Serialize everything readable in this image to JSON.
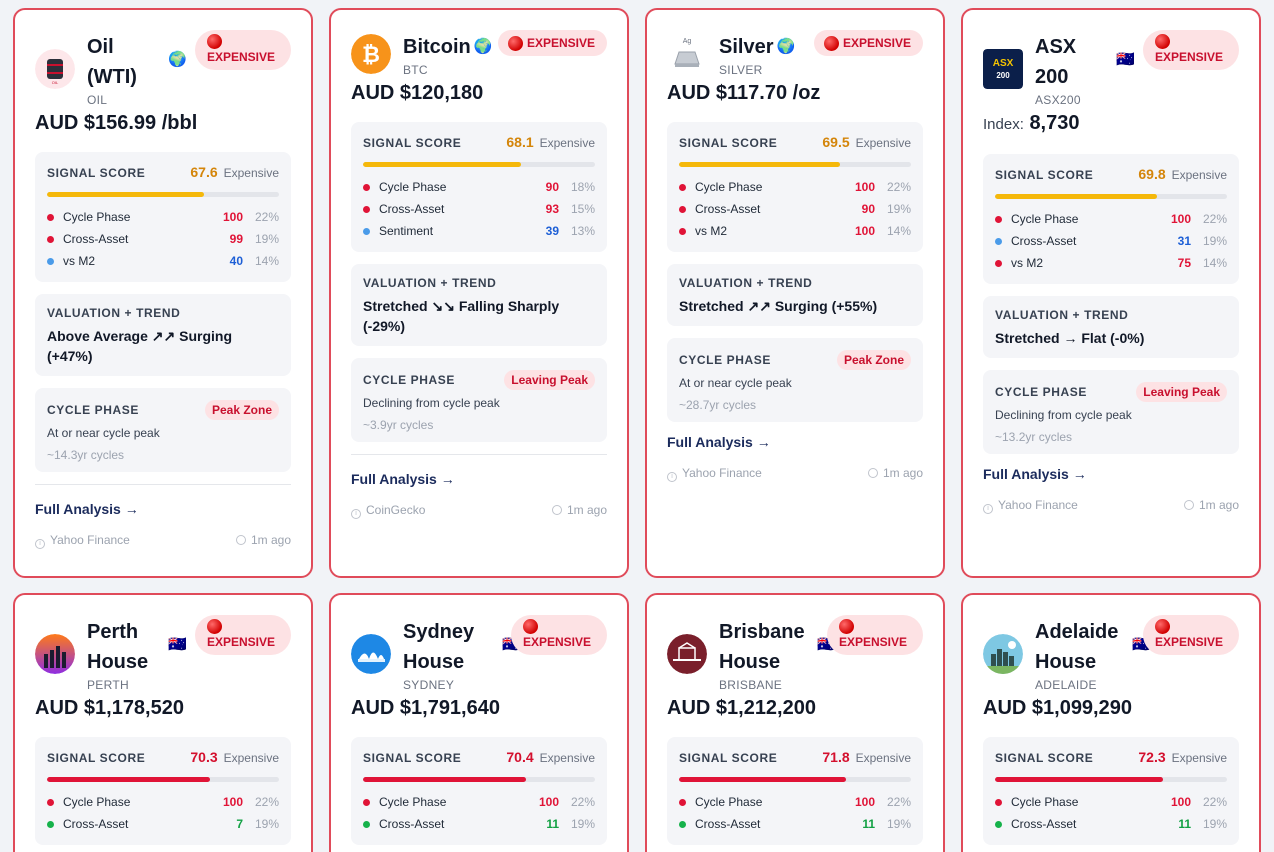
{
  "cards": [
    {
      "name": "Oil (WTI)",
      "ticker": "OIL",
      "flag": "🌍",
      "badge": "EXPENSIVE",
      "price": "AUD $156.99 /bbl",
      "signal": {
        "title": "SIGNAL SCORE",
        "score": "67.6",
        "label": "Expensive",
        "fill": 0.676
      },
      "metrics": [
        {
          "name": "Cycle Phase",
          "value": "100",
          "weight": "22%"
        },
        {
          "name": "Cross-Asset",
          "value": "99",
          "weight": "19%"
        },
        {
          "name": "vs M2",
          "value": "40",
          "weight": "14%"
        }
      ],
      "valuation": {
        "title": "VALUATION + TREND",
        "text": "Above Average ↗↗ Surging (+47%)"
      },
      "cycle": {
        "title": "CYCLE PHASE",
        "badge": "Peak Zone",
        "desc": "At or near cycle peak",
        "sub": "~14.3yr cycles"
      },
      "link": "Full Analysis →",
      "source": "Yahoo Finance",
      "time": "1m ago"
    },
    {
      "name": "Bitcoin",
      "ticker": "BTC",
      "flag": "🌍",
      "badge": "EXPENSIVE",
      "price": "AUD $120,180",
      "signal": {
        "title": "SIGNAL SCORE",
        "score": "68.1",
        "label": "Expensive",
        "fill": 0.681
      },
      "metrics": [
        {
          "name": "Cycle Phase",
          "value": "90",
          "weight": "18%"
        },
        {
          "name": "Cross-Asset",
          "value": "93",
          "weight": "15%"
        },
        {
          "name": "Sentiment",
          "value": "39",
          "weight": "13%"
        }
      ],
      "valuation": {
        "title": "VALUATION + TREND",
        "text": "Stretched ↘↘ Falling Sharply (-29%)"
      },
      "cycle": {
        "title": "CYCLE PHASE",
        "badge": "Leaving Peak",
        "desc": "Declining from cycle peak",
        "sub": "~3.9yr cycles"
      },
      "link": "Full Analysis →",
      "source": "CoinGecko",
      "time": "1m ago"
    },
    {
      "name": "Silver",
      "ticker": "SILVER",
      "flag": "🌍",
      "badge": "EXPENSIVE",
      "price": "AUD $117.70 /oz",
      "signal": {
        "title": "SIGNAL SCORE",
        "score": "69.5",
        "label": "Expensive",
        "fill": 0.695
      },
      "metrics": [
        {
          "name": "Cycle Phase",
          "value": "100",
          "weight": "22%"
        },
        {
          "name": "Cross-Asset",
          "value": "90",
          "weight": "19%"
        },
        {
          "name": "vs M2",
          "value": "100",
          "weight": "14%"
        }
      ],
      "valuation": {
        "title": "VALUATION + TREND",
        "text": "Stretched ↗↗ Surging (+55%)"
      },
      "cycle": {
        "title": "CYCLE PHASE",
        "badge": "Peak Zone",
        "desc": "At or near cycle peak",
        "sub": "~28.7yr cycles"
      },
      "link": "Full Analysis →",
      "source": "Yahoo Finance",
      "time": "1m ago"
    },
    {
      "name": "ASX 200",
      "ticker": "ASX200",
      "flag": "🇦🇺",
      "badge": "EXPENSIVE",
      "logo_text": "ASX\n200",
      "price_label": "Index:",
      "price": "8,730",
      "signal": {
        "title": "SIGNAL SCORE",
        "score": "69.8",
        "label": "Expensive",
        "fill": 0.698
      },
      "metrics": [
        {
          "name": "Cycle Phase",
          "value": "100",
          "weight": "22%"
        },
        {
          "name": "Cross-Asset",
          "value": "31",
          "weight": "19%"
        },
        {
          "name": "vs M2",
          "value": "75",
          "weight": "14%"
        }
      ],
      "valuation": {
        "title": "VALUATION + TREND",
        "text": "Stretched → Flat (-0%)"
      },
      "cycle": {
        "title": "CYCLE PHASE",
        "badge": "Leaving Peak",
        "desc": "Declining from cycle peak",
        "sub": "~13.2yr cycles"
      },
      "link": "Full Analysis →",
      "source": "Yahoo Finance",
      "time": "1m ago"
    },
    {
      "name": "Perth House",
      "ticker": "PERTH",
      "flag": "🇦🇺",
      "badge": "EXPENSIVE",
      "price": "AUD $1,178,520",
      "signal": {
        "title": "SIGNAL SCORE",
        "score": "70.3",
        "label": "Expensive",
        "fill": 0.703
      },
      "metrics": [
        {
          "name": "Cycle Phase",
          "value": "100",
          "weight": "22%"
        },
        {
          "name": "Cross-Asset",
          "value": "7",
          "weight": "19%"
        }
      ]
    },
    {
      "name": "Sydney House",
      "ticker": "SYDNEY",
      "flag": "🇦🇺",
      "badge": "EXPENSIVE",
      "price": "AUD $1,791,640",
      "signal": {
        "title": "SIGNAL SCORE",
        "score": "70.4",
        "label": "Expensive",
        "fill": 0.704
      },
      "metrics": [
        {
          "name": "Cycle Phase",
          "value": "100",
          "weight": "22%"
        },
        {
          "name": "Cross-Asset",
          "value": "11",
          "weight": "19%"
        }
      ]
    },
    {
      "name": "Brisbane House",
      "ticker": "BRISBANE",
      "flag": "🇦🇺",
      "badge": "EXPENSIVE",
      "price": "AUD $1,212,200",
      "signal": {
        "title": "SIGNAL SCORE",
        "score": "71.8",
        "label": "Expensive",
        "fill": 0.718
      },
      "metrics": [
        {
          "name": "Cycle Phase",
          "value": "100",
          "weight": "22%"
        },
        {
          "name": "Cross-Asset",
          "value": "11",
          "weight": "19%"
        }
      ]
    },
    {
      "name": "Adelaide House",
      "ticker": "ADELAIDE",
      "flag": "🇦🇺",
      "badge": "EXPENSIVE",
      "price": "AUD $1,099,290",
      "signal": {
        "title": "SIGNAL SCORE",
        "score": "72.3",
        "label": "Expensive",
        "fill": 0.723
      },
      "metrics": [
        {
          "name": "Cycle Phase",
          "value": "100",
          "weight": "22%"
        },
        {
          "name": "Cross-Asset",
          "value": "11",
          "weight": "19%"
        }
      ]
    }
  ],
  "colors": {
    "border": "#e04b5a",
    "badge_bg": "#fde2e4",
    "badge_text": "#c8102e",
    "bar_amber": "#f5b80a",
    "bar_red": "#e01437"
  }
}
